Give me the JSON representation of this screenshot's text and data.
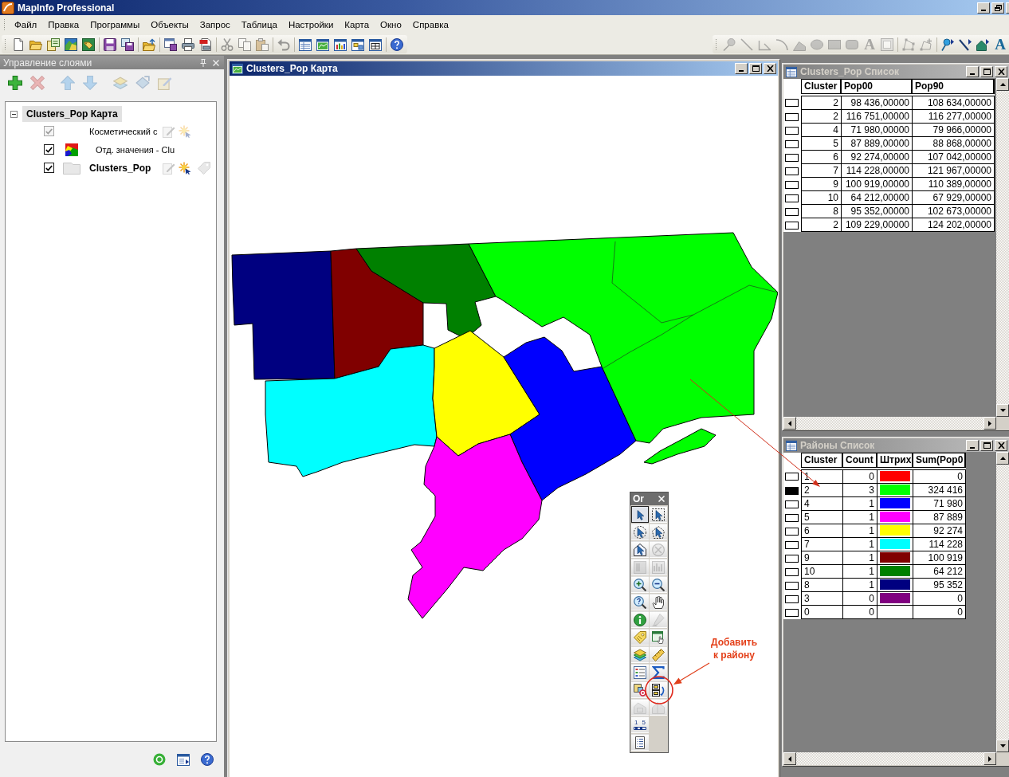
{
  "window": {
    "title": "MapInfo Professional"
  },
  "menu": [
    "Файл",
    "Правка",
    "Программы",
    "Объекты",
    "Запрос",
    "Таблица",
    "Настройки",
    "Карта",
    "Окно",
    "Справка"
  ],
  "main_toolbar": [
    [
      {
        "kind": "new",
        "disabled": false
      },
      {
        "kind": "open",
        "disabled": false
      },
      {
        "kind": "open_workspace",
        "disabled": false
      },
      {
        "kind": "open_map",
        "disabled": false
      },
      {
        "kind": "open_web",
        "disabled": false
      }
    ],
    [
      {
        "kind": "save",
        "disabled": false
      },
      {
        "kind": "save_copy",
        "disabled": false
      }
    ],
    [
      {
        "kind": "open_folder",
        "disabled": false
      }
    ],
    [
      {
        "kind": "new_window",
        "disabled": false
      },
      {
        "kind": "print",
        "disabled": false
      },
      {
        "kind": "export",
        "disabled": false
      }
    ],
    [
      {
        "kind": "cut",
        "disabled": true
      },
      {
        "kind": "copy",
        "disabled": true
      },
      {
        "kind": "paste",
        "disabled": true
      }
    ],
    [
      {
        "kind": "undo",
        "disabled": true
      }
    ],
    [
      {
        "kind": "browser",
        "disabled": false
      },
      {
        "kind": "mapper",
        "disabled": false
      },
      {
        "kind": "graph",
        "disabled": false
      },
      {
        "kind": "layout",
        "disabled": false
      },
      {
        "kind": "redistrict",
        "disabled": false
      }
    ],
    [
      {
        "kind": "help",
        "disabled": false
      }
    ]
  ],
  "drawing_toolbar": [
    [
      {
        "kind": "symbol",
        "disabled": true
      },
      {
        "kind": "line",
        "disabled": true
      },
      {
        "kind": "polyline",
        "disabled": true
      },
      {
        "kind": "arc",
        "disabled": true
      },
      {
        "kind": "polygon",
        "disabled": true
      },
      {
        "kind": "ellipse",
        "disabled": true
      },
      {
        "kind": "rectangle",
        "disabled": true
      },
      {
        "kind": "rounded_rectangle",
        "disabled": true
      },
      {
        "kind": "text",
        "label": "A",
        "disabled": true
      },
      {
        "kind": "frame",
        "disabled": true
      }
    ],
    [
      {
        "kind": "reshape",
        "disabled": true
      },
      {
        "kind": "add_node",
        "disabled": true
      }
    ],
    [
      {
        "kind": "symbol_style",
        "disabled": false
      },
      {
        "kind": "line_style",
        "disabled": false
      },
      {
        "kind": "region_style",
        "disabled": false
      },
      {
        "kind": "text_style",
        "label": "A",
        "disabled": false
      }
    ]
  ],
  "layer_panel": {
    "title": "Управление слоями",
    "toolbar": [
      [
        {
          "kind": "add",
          "disabled": false
        },
        {
          "kind": "remove",
          "disabled": true
        }
      ],
      [
        {
          "kind": "up",
          "disabled": true
        },
        {
          "kind": "down",
          "disabled": true
        }
      ],
      [
        {
          "kind": "props",
          "disabled": true
        },
        {
          "kind": "reorder",
          "disabled": true
        },
        {
          "kind": "label_layer",
          "disabled": true
        }
      ]
    ],
    "tree": {
      "label": "Clusters_Pop Карта",
      "expanded": true,
      "selected": true,
      "children": [
        {
          "kind": "cosmetic",
          "label": "Косметический с",
          "checked": true,
          "disabled": true,
          "editable": false,
          "selectable": false
        },
        {
          "kind": "theme",
          "label": "Отд. значения - Clu",
          "checked": true,
          "disabled": false
        },
        {
          "kind": "layer",
          "label": "Clusters_Pop",
          "checked": true,
          "disabled": false,
          "editable": false,
          "selectable": true,
          "labeled": false
        }
      ]
    },
    "footer": [
      {
        "kind": "ring"
      },
      {
        "kind": "window"
      },
      {
        "kind": "help"
      }
    ]
  },
  "map_window": {
    "title": "Clusters_Pop Карта",
    "active": true
  },
  "palette": {
    "title": "Or",
    "rows": [
      [
        {
          "kind": "select",
          "selected": true,
          "disabled": false
        },
        {
          "kind": "marquee",
          "selected": false,
          "disabled": false
        }
      ],
      [
        {
          "kind": "radius",
          "selected": false,
          "disabled": false
        },
        {
          "kind": "polygon_select",
          "selected": false,
          "disabled": false
        }
      ],
      [
        {
          "kind": "boundary",
          "selected": false,
          "disabled": false
        },
        {
          "kind": "unselect",
          "selected": false,
          "disabled": true
        }
      ],
      [
        {
          "kind": "invert",
          "selected": false,
          "disabled": true
        },
        {
          "kind": "graph_select",
          "selected": false,
          "disabled": true
        }
      ],
      [
        {
          "kind": "zoom_in",
          "selected": false,
          "disabled": false
        },
        {
          "kind": "zoom_out",
          "selected": false,
          "disabled": false
        }
      ],
      [
        {
          "kind": "change_view",
          "selected": false,
          "disabled": false
        },
        {
          "kind": "grabber",
          "selected": false,
          "disabled": false
        }
      ],
      [
        {
          "kind": "info",
          "selected": false,
          "disabled": false
        },
        {
          "kind": "hotlink",
          "selected": false,
          "disabled": true
        }
      ],
      [
        {
          "kind": "label_tool",
          "selected": false,
          "disabled": false
        },
        {
          "kind": "drag_window",
          "selected": false,
          "disabled": false
        }
      ],
      [
        {
          "kind": "layer_control",
          "selected": false,
          "disabled": false
        },
        {
          "kind": "ruler",
          "selected": false,
          "disabled": false
        }
      ],
      [
        {
          "kind": "legend",
          "selected": false,
          "disabled": false
        },
        {
          "kind": "statistics",
          "selected": false,
          "disabled": false
        }
      ],
      [
        {
          "kind": "set_target",
          "selected": false,
          "disabled": false
        },
        {
          "kind": "assign",
          "selected": false,
          "disabled": false
        }
      ],
      [
        {
          "kind": "clip_region",
          "selected": false,
          "disabled": true
        },
        {
          "kind": "split",
          "selected": false,
          "disabled": true
        }
      ],
      [
        {
          "kind": "scale_bar",
          "label": "1 5",
          "selected": false,
          "disabled": false
        }
      ],
      [
        {
          "kind": "list",
          "selected": false,
          "disabled": false
        }
      ]
    ]
  },
  "callout": {
    "text": "Добавить к району"
  },
  "browsers": [
    {
      "title": "Clusters_Pop Список",
      "active": false,
      "columns": [
        {
          "label": "Cluster",
          "kind": "number"
        },
        {
          "label": "Pop00",
          "kind": "number"
        },
        {
          "label": "Pop90",
          "kind": "number"
        }
      ],
      "rows": [
        {
          "selected": false,
          "cells": [
            "2",
            "98 436,00000",
            "108 634,00000"
          ]
        },
        {
          "selected": false,
          "cells": [
            "2",
            "116 751,00000",
            "116 277,00000"
          ]
        },
        {
          "selected": false,
          "cells": [
            "4",
            "71 980,00000",
            "79 966,00000"
          ]
        },
        {
          "selected": false,
          "cells": [
            "5",
            "87 889,00000",
            "88 868,00000"
          ]
        },
        {
          "selected": false,
          "cells": [
            "6",
            "92 274,00000",
            "107 042,00000"
          ]
        },
        {
          "selected": false,
          "cells": [
            "7",
            "114 228,00000",
            "121 967,00000"
          ]
        },
        {
          "selected": false,
          "cells": [
            "9",
            "100 919,00000",
            "110 389,00000"
          ]
        },
        {
          "selected": false,
          "cells": [
            "10",
            "64 212,00000",
            "67 929,00000"
          ]
        },
        {
          "selected": false,
          "cells": [
            "8",
            "95 352,00000",
            "102 673,00000"
          ]
        },
        {
          "selected": false,
          "cells": [
            "2",
            "109 229,00000",
            "124 202,00000"
          ]
        }
      ]
    },
    {
      "title": "Районы Список",
      "active": false,
      "columns": [
        {
          "label": "Cluster",
          "kind": "text"
        },
        {
          "label": "Count",
          "kind": "number"
        },
        {
          "label": "Штрих",
          "kind": "swatch"
        },
        {
          "label": "Sum(Pop0",
          "kind": "number"
        }
      ],
      "rows": [
        {
          "selected": false,
          "color": "#ff0000",
          "cells": [
            "1",
            "0",
            "0"
          ]
        },
        {
          "selected": true,
          "color": "#00ff00",
          "cells": [
            "2",
            "3",
            "324 416"
          ]
        },
        {
          "selected": false,
          "color": "#0000ff",
          "cells": [
            "4",
            "1",
            "71 980"
          ]
        },
        {
          "selected": false,
          "color": "#ff00ff",
          "cells": [
            "5",
            "1",
            "87 889"
          ]
        },
        {
          "selected": false,
          "color": "#ffff00",
          "cells": [
            "6",
            "1",
            "92 274"
          ]
        },
        {
          "selected": false,
          "color": "#00ffff",
          "cells": [
            "7",
            "1",
            "114 228"
          ]
        },
        {
          "selected": false,
          "color": "#800000",
          "cells": [
            "9",
            "1",
            "100 919"
          ]
        },
        {
          "selected": false,
          "color": "#008000",
          "cells": [
            "10",
            "1",
            "64 212"
          ]
        },
        {
          "selected": false,
          "color": "#000080",
          "cells": [
            "8",
            "1",
            "95 352"
          ]
        },
        {
          "selected": false,
          "color": "#800080",
          "cells": [
            "3",
            "0",
            "0"
          ]
        },
        {
          "selected": false,
          "cells": [
            "0",
            "0",
            "0"
          ]
        }
      ]
    }
  ]
}
